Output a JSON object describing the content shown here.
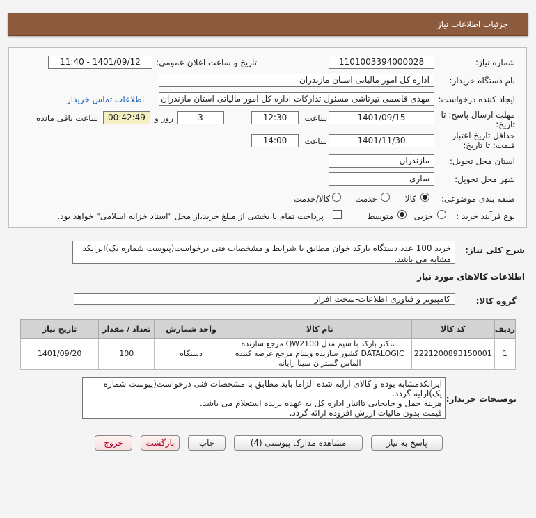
{
  "header": {
    "title": "جزئیات اطلاعات نیاز"
  },
  "form": {
    "need_number_label": "شماره نیاز:",
    "need_number": "1101003394000028",
    "announce_label": "تاریخ و ساعت اعلان عمومی:",
    "announce_value": "1401/09/12 - 11:40",
    "buyer_label": "نام دستگاه خریدار:",
    "buyer_value": "اداره کل امور مالیاتی استان مازندران",
    "requester_label": "ایجاد کننده درخواست:",
    "requester_value": "مهدی قاسمی تیرتاشی مسئول تدارکات اداره کل امور مالیاتی استان مازندران",
    "contact_link": "اطلاعات تماس خریدار",
    "deadline_label_1": "مهلت ارسال پاسخ: تا",
    "deadline_label_2": "تاریخ:",
    "deadline_date": "1401/09/15",
    "time_label": "ساعت",
    "deadline_time": "12:30",
    "days_value": "3",
    "days_label": "روز و",
    "remaining_value": "00:42:49",
    "remaining_label": "ساعت باقی مانده",
    "validity_label_1": "حداقل تاریخ اعتبار",
    "validity_label_2": "قیمت: تا تاریخ:",
    "validity_date": "1401/11/30",
    "validity_time": "14:00",
    "province_label": "استان محل تحویل:",
    "province_value": "مازندران",
    "city_label": "شهر محل تحویل:",
    "city_value": "ساری",
    "category_label": "طبقه بندی موضوعی:",
    "category_options": [
      "کالا",
      "خدمت",
      "کالا/خدمت"
    ],
    "process_label": "نوع فرآیند خرید :",
    "process_options": [
      "جزیی",
      "متوسط"
    ],
    "payment_note": "پرداخت تمام یا بخشی از مبلغ خرید،از محل \"اسناد خزانه اسلامی\" خواهد بود."
  },
  "summary": {
    "label": "شرح کلی نیاز:",
    "text": "خرید 100 عدد دستگاه بارکد خوان مطابق با شرایط و مشخصات فنی درخواست(پیوست شماره یک)ایرانکد مشابه می باشد."
  },
  "goods": {
    "section_title": "اطلاعات کالاهای مورد نیاز",
    "group_label": "گروه کالا:",
    "group_value": "کامپیوتر و فناوری اطلاعات-سخت افزار",
    "columns": [
      "ردیف",
      "کد کالا",
      "نام کالا",
      "واحد شمارش",
      "تعداد / مقدار",
      "تاریخ نیاز"
    ],
    "rows": [
      {
        "row": "1",
        "code": "2221200893150001",
        "name": "اسکنر بارکد با سیم مدل QW2100 مرجع سازنده DATALOGIC کشور سازنده ویتنام مرجع عرضه کننده الماس گستران سینا رایانه",
        "unit": "دستگاه",
        "qty": "100",
        "date": "1401/09/20"
      }
    ]
  },
  "buyer_notes": {
    "label": "توضیحات خریدار:",
    "lines": [
      "ایرانکدمشابه بوده و کالای ارایه شده الزاما باید مطابق با مشخصات فنی درخواست(پیوست شماره یک)ارایه گردد.",
      "هزینه حمل و جابجایی تاانبار اداره کل به عهده برنده استعلام می باشد.",
      "قیمت بدون مالیات ارزش افزوده ارائه گردد."
    ]
  },
  "buttons": {
    "reply": "پاسخ به نیاز",
    "attachments": "مشاهده مدارک پیوستی (4)",
    "print": "چاپ",
    "back": "بازگشت",
    "exit": "خروج"
  }
}
